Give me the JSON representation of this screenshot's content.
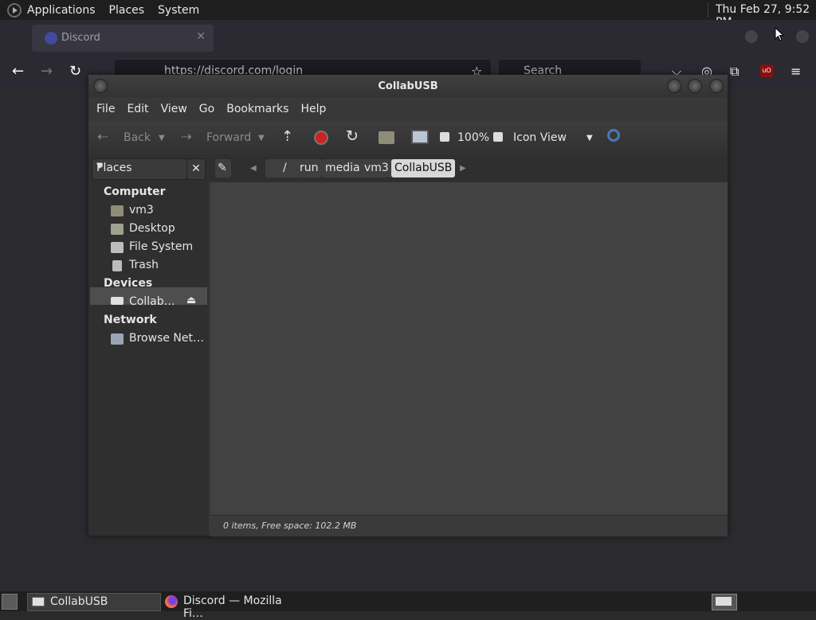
{
  "top_panel": {
    "menus": [
      "Applications",
      "Places",
      "System"
    ],
    "clock": "Thu Feb 27,  9:52 PM"
  },
  "firefox": {
    "tab_title": "Discord",
    "url": "https://discord.com/login",
    "search_placeholder": "Search"
  },
  "window": {
    "title": "CollabUSB",
    "menu": [
      "File",
      "Edit",
      "View",
      "Go",
      "Bookmarks",
      "Help"
    ],
    "toolbar": {
      "back": "Back",
      "forward": "Forward",
      "zoom": "100%",
      "view_mode": "Icon View"
    },
    "side_pane_selector": "Places",
    "path": {
      "root": "/",
      "segments": [
        "run",
        "media",
        "vm3",
        "CollabUSB"
      ]
    },
    "sidebar": {
      "computer_heading": "Computer",
      "computer_items": [
        "vm3",
        "Desktop",
        "File System",
        "Trash"
      ],
      "devices_heading": "Devices",
      "device_item": "Collab…",
      "network_heading": "Network",
      "network_item": "Browse Net…"
    },
    "status": "0 items, Free space: 102.2 MB"
  },
  "bottom_panel": {
    "tasks": [
      "CollabUSB",
      "Discord — Mozilla Fi…"
    ]
  }
}
